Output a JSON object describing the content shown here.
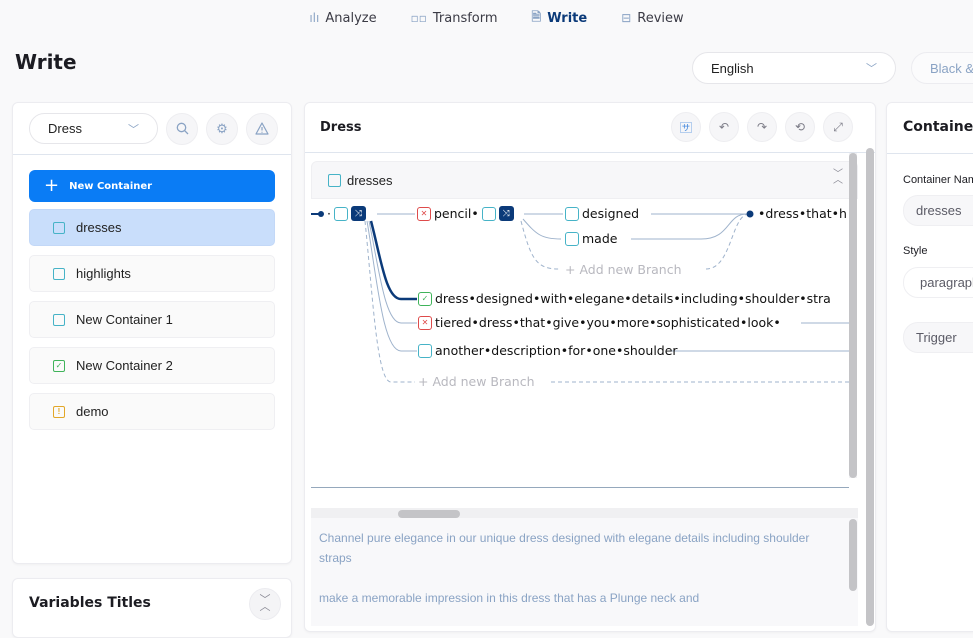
{
  "nav": {
    "items": [
      {
        "label": "Analyze",
        "icon": "bar-chart-icon",
        "active": false
      },
      {
        "label": "Transform",
        "icon": "grid-icon",
        "active": false
      },
      {
        "label": "Write",
        "icon": "document-icon",
        "active": true
      },
      {
        "label": "Review",
        "icon": "folder-icon",
        "active": false
      }
    ]
  },
  "header": {
    "title": "Write",
    "language": "English",
    "theme": "Black &"
  },
  "left": {
    "dropdown": "Dress",
    "new_container_label": "New Container",
    "containers": [
      {
        "label": "dresses",
        "status": "empty",
        "selected": true
      },
      {
        "label": "highlights",
        "status": "empty",
        "selected": false
      },
      {
        "label": "New Container 1",
        "status": "empty",
        "selected": false
      },
      {
        "label": "New Container 2",
        "status": "ok",
        "selected": false
      },
      {
        "label": "demo",
        "status": "warn",
        "selected": false
      }
    ],
    "variables_title": "Variables Titles"
  },
  "middle": {
    "title": "Dress",
    "container_name": "dresses",
    "nodes": {
      "pencil": "pencil•",
      "designed": "designed",
      "made": "made",
      "dress_that": "•dress•that•h",
      "branch1": "dress•designed•with•elegane•details•including•shoulder•stra",
      "branch2": "tiered•dress•that•give•you•more•sophisticated•look•",
      "branch3": "another•description•for•one•shoulder",
      "add_branch": "+ Add new Branch"
    },
    "preview": [
      "Channel pure elegance in our unique dress designed with elegane details including shoulder straps",
      "make a memorable impression in this dress that has a Plunge neck and"
    ]
  },
  "right": {
    "title": "Container",
    "container_name_label": "Container Name",
    "container_name_value": "dresses",
    "style_label": "Style",
    "style_value": "paragraph",
    "trigger_label": "Trigger"
  },
  "colors": {
    "primary": "#0a7cf5",
    "nav_active": "#0b3a79",
    "selected_bg": "#c9defb",
    "ok": "#3fb35a",
    "error": "#de4b4b",
    "warn": "#e2a728",
    "empty": "#46b3c7"
  }
}
